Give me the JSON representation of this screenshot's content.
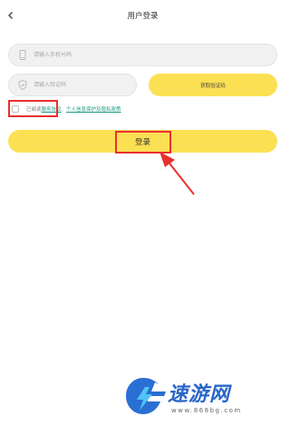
{
  "header": {
    "back_icon": "chevron-left-icon",
    "title": "用户登录"
  },
  "form": {
    "phone_icon": "phone-icon",
    "phone_placeholder": "请输入手机号码",
    "code_icon": "shield-icon",
    "code_placeholder": "请输入验证码",
    "get_code_label": "获取验证码",
    "agreement": {
      "prefix": "已阅读",
      "service_link": "服务协议",
      "separator": "、",
      "privacy_link": "个人信息保护及隐私政策"
    },
    "login_label": "登录"
  },
  "watermark": {
    "brand": "速游网",
    "url": "www.868bg.com"
  },
  "colors": {
    "accent": "#fbe053",
    "highlight": "#e8302f",
    "link": "#1f9a86"
  }
}
